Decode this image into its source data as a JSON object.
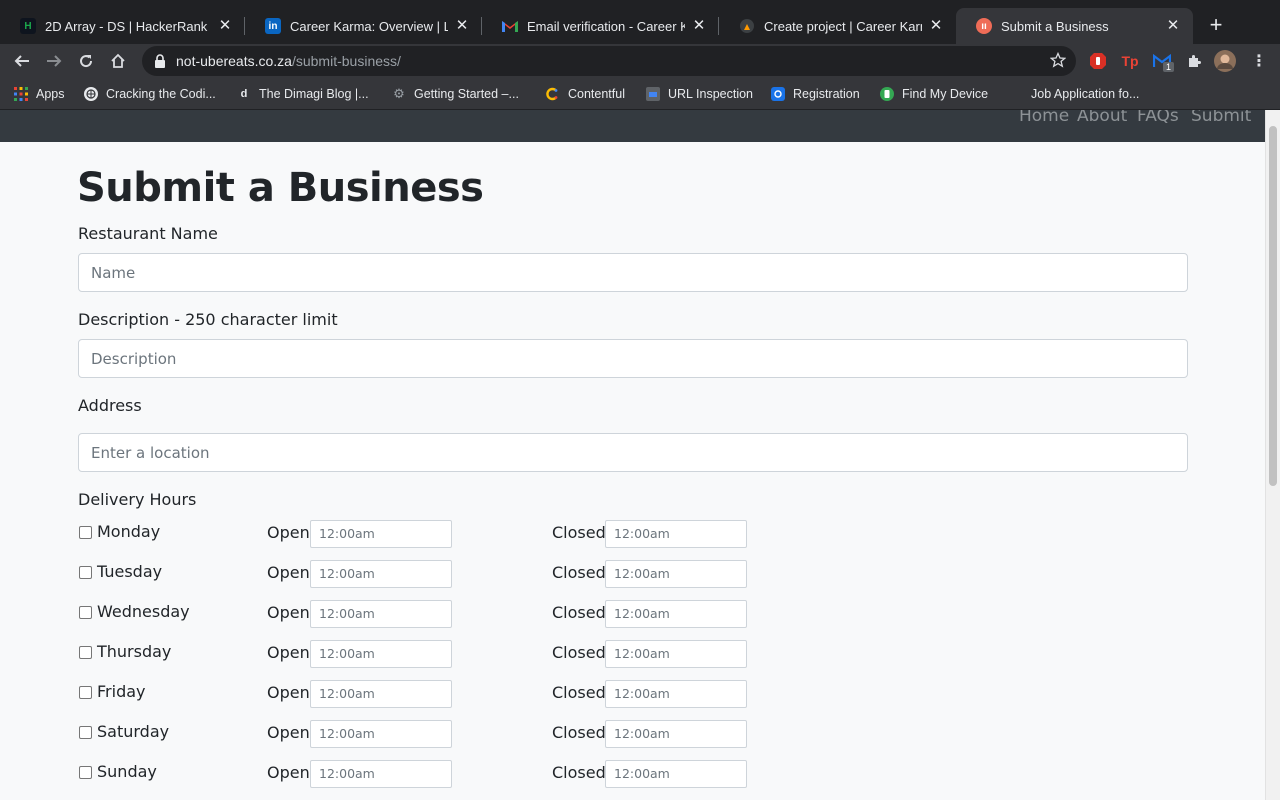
{
  "browser": {
    "tabs": [
      {
        "title": "2D Array - DS | HackerRank",
        "icon": "hackerrank-icon",
        "color": "#1ba94c"
      },
      {
        "title": "Career Karma: Overview | LinkedIn",
        "icon": "linkedin-icon",
        "color": "#0a66c2"
      },
      {
        "title": "Email verification - Career Karma",
        "icon": "gmail-icon",
        "color": "#ea4335"
      },
      {
        "title": "Create project | Career Karma",
        "icon": "career-karma-icon",
        "color": "#ff9900"
      },
      {
        "title": "Submit a Business",
        "icon": "ubereats-icon",
        "color": "#ef6c57"
      }
    ],
    "url_host": "not-ubereats.co.za",
    "url_path": "/submit-business/",
    "bookmarks": [
      {
        "label": "Apps",
        "icon": "apps-grid-icon"
      },
      {
        "label": "Cracking the Codi...",
        "icon": "globe-icon"
      },
      {
        "label": "The Dimagi Blog |...",
        "icon": "dimagi-icon"
      },
      {
        "label": "Getting Started –...",
        "icon": "gear-icon"
      },
      {
        "label": "Contentful",
        "icon": "contentful-icon"
      },
      {
        "label": "URL Inspection",
        "icon": "search-console-icon"
      },
      {
        "label": "Registration",
        "icon": "registration-icon"
      },
      {
        "label": "Find My Device",
        "icon": "find-device-icon"
      },
      {
        "label": "Job Application fo...",
        "icon": ""
      }
    ],
    "extension_badge": "1"
  },
  "site_nav": {
    "links": [
      "Home",
      "About",
      "FAQs",
      "Submit"
    ]
  },
  "form": {
    "title": "Submit a Business",
    "name_label": "Restaurant Name",
    "name_placeholder": "Name",
    "description_label": "Description - 250 character limit",
    "description_placeholder": "Description",
    "address_label": "Address",
    "address_placeholder": "Enter a location",
    "hours_label": "Delivery Hours",
    "open_label": "Open:",
    "closed_label": "Closed:",
    "days": [
      {
        "day": "Monday",
        "open": "12:00am",
        "closed": "12:00am"
      },
      {
        "day": "Tuesday",
        "open": "12:00am",
        "closed": "12:00am"
      },
      {
        "day": "Wednesday",
        "open": "12:00am",
        "closed": "12:00am"
      },
      {
        "day": "Thursday",
        "open": "12:00am",
        "closed": "12:00am"
      },
      {
        "day": "Friday",
        "open": "12:00am",
        "closed": "12:00am"
      },
      {
        "day": "Saturday",
        "open": "12:00am",
        "closed": "12:00am"
      },
      {
        "day": "Sunday",
        "open": "12:00am",
        "closed": "12:00am"
      }
    ]
  }
}
